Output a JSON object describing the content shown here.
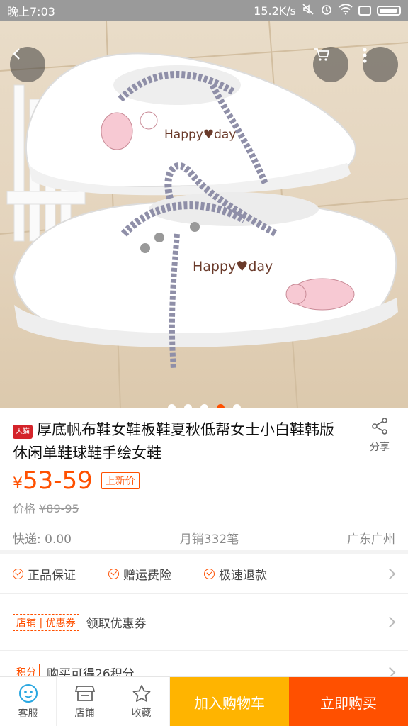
{
  "status_bar": {
    "time": "晚上7:03",
    "network_speed": "15.2K/s"
  },
  "hero": {
    "shoe_text_1": "Happy♥day",
    "shoe_text_2": "Happy♥day",
    "dots_count": 5,
    "active_dot_index": 3
  },
  "product": {
    "shop_badge": "天猫",
    "title": "厚底帆布鞋女鞋板鞋夏秋低帮女士小白鞋韩版休闲单鞋球鞋手绘女鞋",
    "share_label": "分享",
    "price_symbol": "¥",
    "price": "53-59",
    "new_price_tag": "上新价",
    "orig_price_label": "价格 ",
    "orig_price": "¥89-95",
    "shipping": "快递: 0.00",
    "monthly_sales": "月销332笔",
    "location": "广东广州"
  },
  "services": {
    "items": [
      "正品保证",
      "赠运费险",
      "极速退款"
    ]
  },
  "coupon": {
    "tag": "店铺 | 优惠券",
    "text": "领取优惠券"
  },
  "points": {
    "tag": "积分",
    "text": "购买可得26积分"
  },
  "bottom_bar": {
    "service_label": "客服",
    "shop_label": "店铺",
    "favorite_label": "收藏",
    "add_cart_label": "加入购物车",
    "buy_now_label": "立即购买"
  },
  "colors": {
    "accent": "#ff5000",
    "cart": "#ffb400",
    "tmall_red": "#d4232a"
  }
}
